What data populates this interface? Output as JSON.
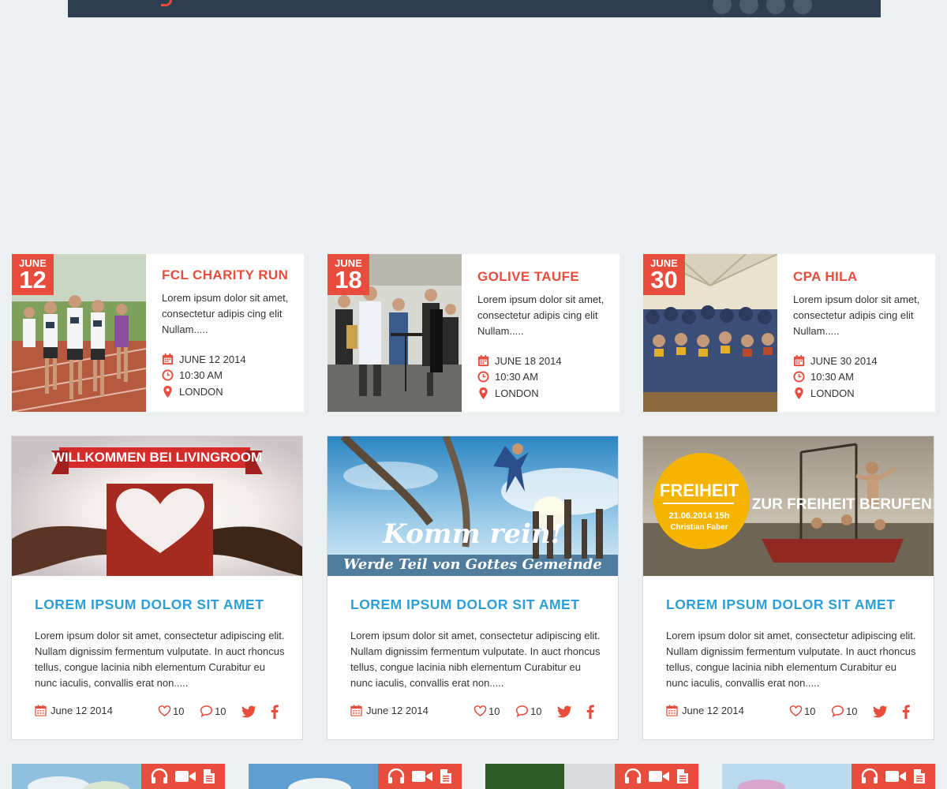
{
  "header": {
    "social_icons": [
      "rss-icon",
      "google-plus-icon",
      "facebook-icon",
      "twitter-icon"
    ]
  },
  "events": [
    {
      "month": "JUNE",
      "day": "12",
      "title": "FCL CHARITY RUN",
      "text": "Lorem ipsum dolor sit amet, consectetur adipis cing elit Nullam.....",
      "date": "JUNE 12 2014",
      "time": "10:30 AM",
      "location": "LONDON"
    },
    {
      "month": "JUNE",
      "day": "18",
      "title": "GOLIVE TAUFE",
      "text": "Lorem ipsum dolor sit amet, consectetur adipis cing elit Nullam.....",
      "date": "JUNE 18 2014",
      "time": "10:30 AM",
      "location": "LONDON"
    },
    {
      "month": "JUNE",
      "day": "30",
      "title": "CPA HILA",
      "text": "Lorem ipsum dolor sit amet, consectetur adipis cing elit Nullam.....",
      "date": "JUNE 30 2014",
      "time": "10:30 AM",
      "location": "LONDON"
    }
  ],
  "posts": [
    {
      "banner": "WILLKOMMEN BEI LIVINGROOM",
      "title": "LOREM IPSUM DOLOR SIT AMET",
      "text": "Lorem ipsum dolor sit amet, consectetur adipiscing elit. Nullam dignissim fermentum vulputate. In auct rhoncus tellus, congue lacinia nibh elementum Curabitur eu nunc iaculis, convallis erat non.....",
      "date": "June 12 2014",
      "likes": "10",
      "comments": "10"
    },
    {
      "banner_line1": "Komm rein!",
      "banner_line2": "Werde Teil von Gottes Gemeinde",
      "title": "LOREM IPSUM DOLOR SIT AMET",
      "text": "Lorem ipsum dolor sit amet, consectetur adipiscing elit. Nullam dignissim fermentum vulputate. In auct rhoncus tellus, congue lacinia nibh elementum Curabitur eu nunc iaculis, convallis erat non.....",
      "date": "June 12 2014",
      "likes": "10",
      "comments": "10"
    },
    {
      "circle_title": "FREIHEIT",
      "circle_date": "21.06.2014  15h",
      "circle_name": "Christian Faber",
      "headline": "ZUR FREIHEIT BERUFEN!",
      "title": "LOREM IPSUM DOLOR SIT AMET",
      "text": "Lorem ipsum dolor sit amet, consectetur adipiscing elit. Nullam dignissim fermentum vulputate. In auct rhoncus tellus, congue lacinia nibh elementum Curabitur eu nunc iaculis, convallis erat non.....",
      "date": "June 12 2014",
      "likes": "10",
      "comments": "10"
    }
  ],
  "media_cards": [
    {
      "icons": [
        "headphones-icon",
        "video-icon",
        "document-icon"
      ]
    },
    {
      "icons": [
        "headphones-icon",
        "video-icon",
        "document-icon"
      ]
    },
    {
      "icons": [
        "headphones-icon",
        "video-icon",
        "document-icon"
      ]
    },
    {
      "icons": [
        "headphones-icon",
        "video-icon",
        "document-icon"
      ]
    }
  ],
  "colors": {
    "accent": "#e74c3c",
    "title_blue": "#2e9fd6",
    "header_bg": "#2c3e50",
    "page_bg": "#ecf0f1"
  }
}
